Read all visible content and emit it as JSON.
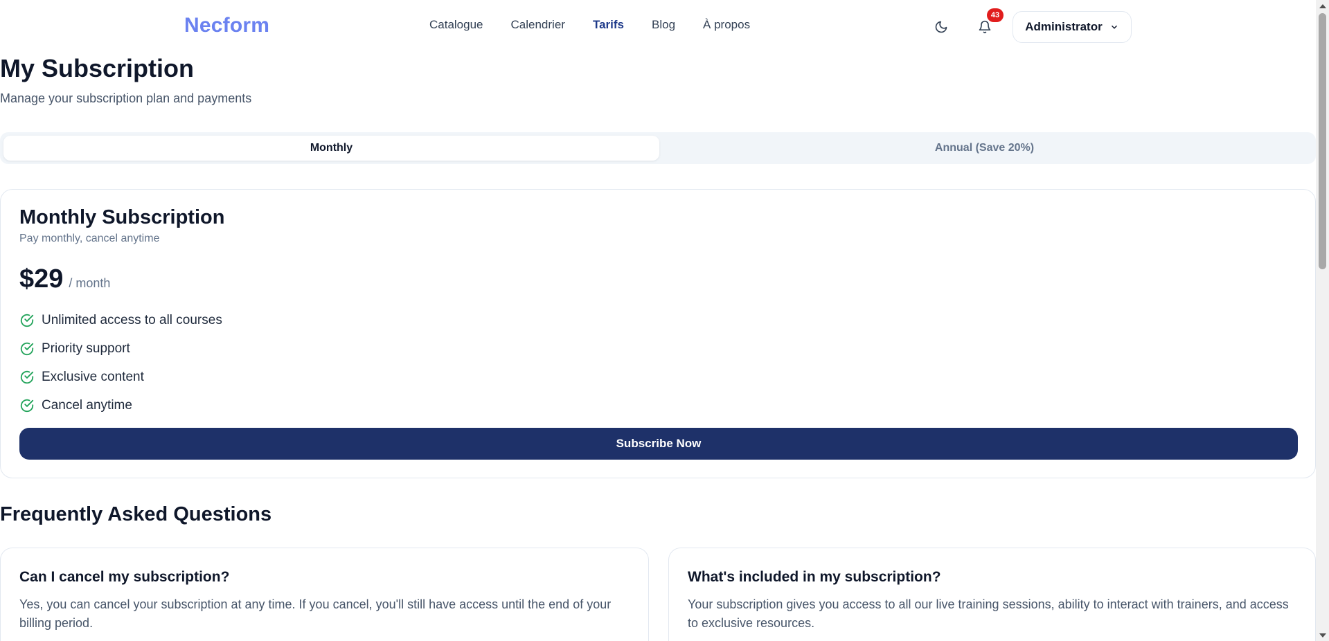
{
  "header": {
    "logo": "Necform",
    "nav": [
      {
        "label": "Catalogue"
      },
      {
        "label": "Calendrier"
      },
      {
        "label": "Tarifs"
      },
      {
        "label": "Blog"
      },
      {
        "label": "À propos"
      }
    ],
    "active_nav": "Tarifs",
    "theme_icon": "moon-icon",
    "notification_icon": "bell-icon",
    "notification_count": "43",
    "user_label": "Administrator"
  },
  "page": {
    "title": "My Subscription",
    "subtitle": "Manage your subscription plan and payments"
  },
  "billing_toggle": {
    "options": [
      {
        "label": "Monthly"
      },
      {
        "label": "Annual (Save 20%)"
      }
    ],
    "selected": "Monthly"
  },
  "plan": {
    "title": "Monthly Subscription",
    "description": "Pay monthly, cancel anytime",
    "price": "$29",
    "period": "/ month",
    "features": [
      "Unlimited access to all courses",
      "Priority support",
      "Exclusive content",
      "Cancel anytime"
    ],
    "cta": "Subscribe Now"
  },
  "faq": {
    "title": "Frequently Asked Questions",
    "items": [
      {
        "question": "Can I cancel my subscription?",
        "answer": "Yes, you can cancel your subscription at any time. If you cancel, you'll still have access until the end of your billing period."
      },
      {
        "question": "What's included in my subscription?",
        "answer": "Your subscription gives you access to all our live training sessions, ability to interact with trainers, and access to exclusive resources."
      }
    ]
  },
  "colors": {
    "brand": "#6b82f0",
    "primary_button": "#1e3169",
    "badge": "#e11d1d",
    "check": "#22a35a"
  }
}
